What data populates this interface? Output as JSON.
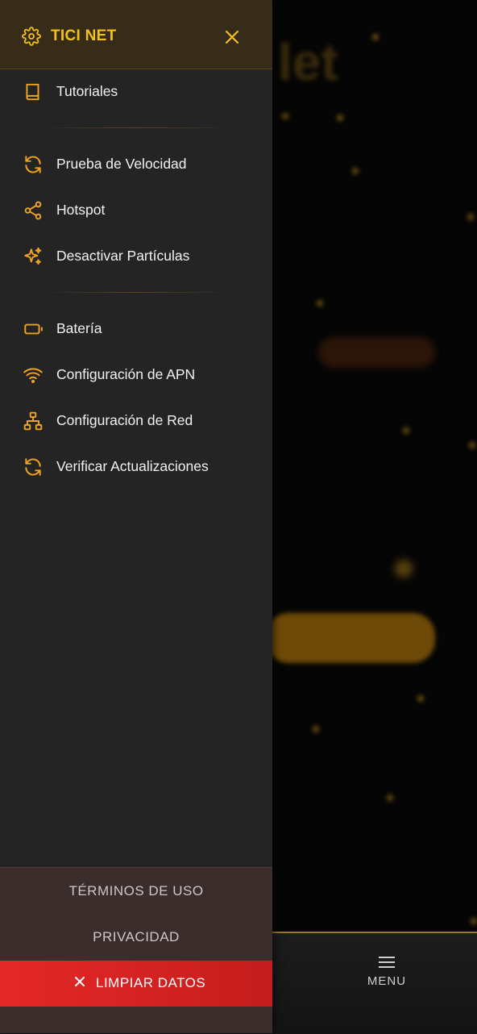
{
  "drawer": {
    "brand": "TICI NET",
    "items_group1": [
      {
        "label": "Tutoriales",
        "icon": "book-icon"
      }
    ],
    "items_group2": [
      {
        "label": "Prueba de Velocidad",
        "icon": "refresh-icon"
      },
      {
        "label": "Hotspot",
        "icon": "share-icon"
      },
      {
        "label": "Desactivar Partículas",
        "icon": "sparkles-icon"
      }
    ],
    "items_group3": [
      {
        "label": "Batería",
        "icon": "battery-icon"
      },
      {
        "label": "Configuración de APN",
        "icon": "wifi-icon"
      },
      {
        "label": "Configuración de Red",
        "icon": "network-icon"
      },
      {
        "label": "Verificar Actualizaciones",
        "icon": "refresh-icon"
      }
    ],
    "footer": {
      "terms": "TÉRMINOS DE USO",
      "privacy": "PRIVACIDAD",
      "clear": "LIMPIAR DATOS"
    }
  },
  "bottom_nav": {
    "menu_label": "MENU"
  },
  "colors": {
    "accent": "#f2c21c",
    "drawer_bg": "#242424",
    "header_bg": "#372b19",
    "danger": "#e52828"
  }
}
